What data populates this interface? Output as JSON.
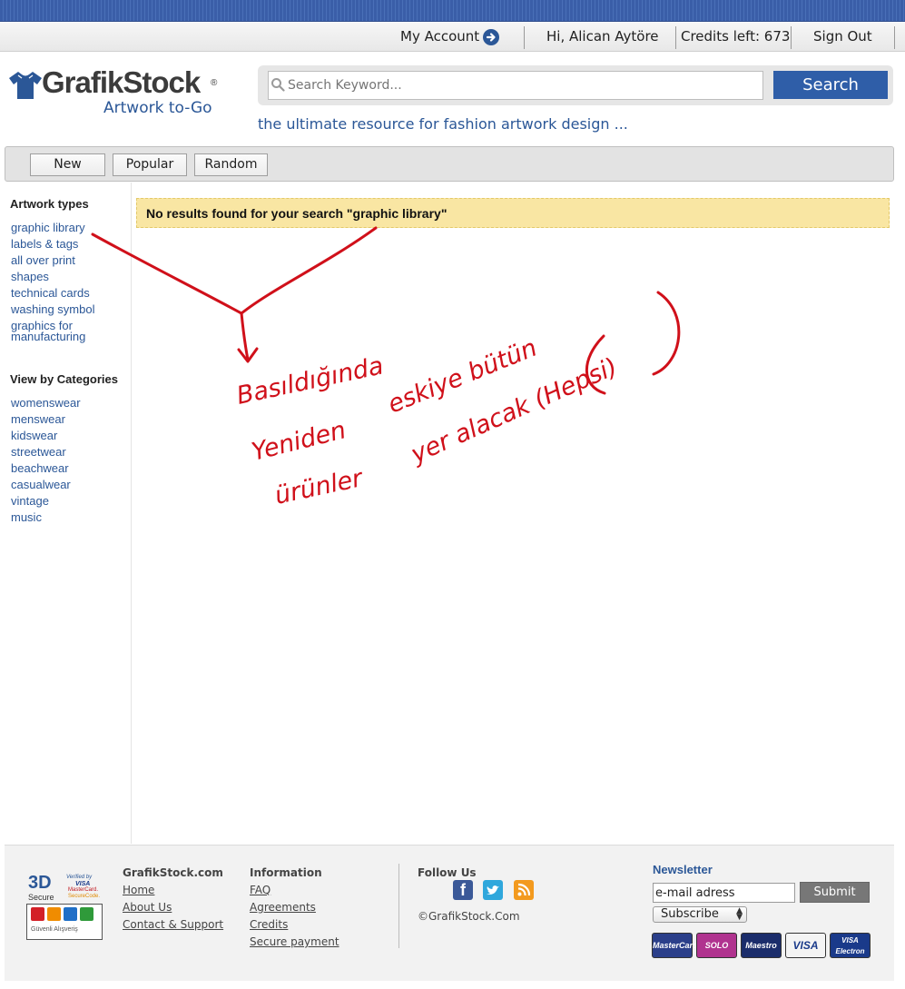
{
  "account_bar": {
    "my_account": "My Account",
    "greeting": "Hi, Alican Aytöre",
    "credits": "Credits left: 673",
    "sign_out": "Sign Out"
  },
  "header": {
    "logo_name": "GrafikStock",
    "logo_reg": "®",
    "logo_tagline": "Artwork to-Go",
    "search_placeholder": "Search Keyword...",
    "search_button": "Search",
    "slogan": "the ultimate resource for fashion artwork design ..."
  },
  "tabs": [
    {
      "label": "New"
    },
    {
      "label": "Popular"
    },
    {
      "label": "Random"
    }
  ],
  "sidebar": {
    "artwork_types_title": "Artwork types",
    "artwork_types": [
      "graphic library",
      "labels & tags",
      "all over print",
      "shapes",
      "technical cards",
      "washing symbol",
      "graphics for manufacturing"
    ],
    "categories_title": "View by Categories",
    "categories": [
      "womenswear",
      "menswear",
      "kidswear",
      "streetwear",
      "beachwear",
      "casualwear",
      "vintage",
      "music"
    ]
  },
  "main": {
    "no_results": "No results found for your search \"graphic library\""
  },
  "annotation": {
    "line1": "Basıldığında",
    "line2": "eskiye bütün",
    "line3": "Yeniden",
    "line4": "yer alacak (Hepsi)",
    "line5": "ürünler",
    "color": "#d0101a"
  },
  "footer": {
    "col1_title": "GrafikStock.com",
    "col1_links": [
      "Home",
      "About Us",
      "Contact & Support"
    ],
    "col2_title": "Information",
    "col2_links": [
      "FAQ",
      "Agreements",
      "Credits",
      "Secure payment"
    ],
    "follow_title": "Follow Us",
    "social_icons": [
      "facebook-icon",
      "twitter-icon",
      "rss-icon"
    ],
    "copyright": "©GrafikStock.Com",
    "newsletter_title": "Newsletter",
    "email_value": "e-mail adress",
    "submit_label": "Submit",
    "subscribe_value": "Subscribe",
    "badge": {
      "label_3d": "3D",
      "secure": "Secure",
      "verified": "Verified by",
      "visa": "VISA",
      "mastercard": "MasterCard.",
      "securecode": "SecureCode.",
      "guvenli": "Güvenli Alışveriş"
    },
    "cards": [
      "MasterCard",
      "SOLO",
      "Maestro",
      "VISA",
      "VISA Electron"
    ]
  },
  "colors": {
    "accent": "#2b5797",
    "search_button": "#2f5ea8",
    "notice_bg": "#f9e6a3"
  }
}
